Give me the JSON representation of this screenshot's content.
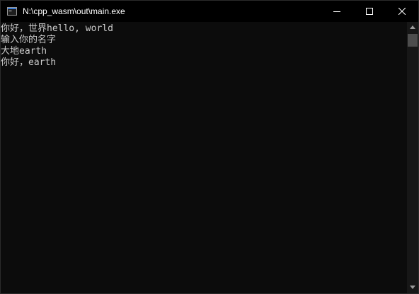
{
  "window": {
    "title": "N:\\cpp_wasm\\out\\main.exe",
    "app_icon": "console-app-icon"
  },
  "caption_buttons": {
    "minimize_icon": "minimize-icon",
    "maximize_icon": "maximize-icon",
    "close_icon": "close-icon"
  },
  "console": {
    "lines": [
      "你好，世界hello, world",
      "输入你的名字",
      "大地earth",
      "你好，earth"
    ],
    "text_color": "#cccccc",
    "background_color": "#0c0c0c"
  },
  "scrollbar": {
    "up_icon": "scroll-up-arrow-icon",
    "down_icon": "scroll-down-arrow-icon"
  },
  "colors": {
    "titlebar_bg": "#000000",
    "titlebar_text": "#ffffff",
    "scrollbar_track": "#171717",
    "scrollbar_thumb": "#4d4d4d"
  }
}
